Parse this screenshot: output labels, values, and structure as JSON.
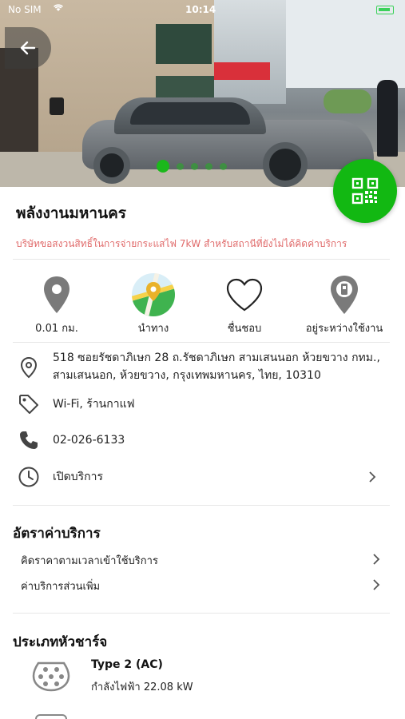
{
  "status_bar": {
    "carrier": "No SIM",
    "time": "10:14"
  },
  "hero": {
    "slides_count": 5,
    "active_slide": 1
  },
  "station": {
    "name": "พลังงานมหานคร",
    "notice": "บริษัทขอสงวนสิทธิ์ในการจ่ายกระแสไฟ 7kW สำหรับสถานีที่ยังไม่ได้คิดค่าบริการ"
  },
  "actions": [
    {
      "label": "0.01 กม.",
      "icon": "map-pin-icon"
    },
    {
      "label": "นำทาง",
      "icon": "maps-app-icon"
    },
    {
      "label": "ชื่นชอบ",
      "icon": "heart-icon"
    },
    {
      "label": "อยู่ระหว่างใช้งาน",
      "icon": "charging-pin-icon"
    }
  ],
  "info": {
    "address_line1": "518 ซอยรัชดาภิเษก 28 ถ.รัชดาภิเษก สามเสนนอก ห้วยขวาง กทม.,",
    "address_line2": "สามเสนนอก, ห้วยขวาง, กรุงเทพมหานคร, ไทย, 10310",
    "amenities": "Wi-Fi, ร้านกาแฟ",
    "phone": "02-026-6133",
    "hours": "เปิดบริการ"
  },
  "rates": {
    "title": "อัตราค่าบริการ",
    "items": [
      "คิดราคาตามเวลาเข้าใช้บริการ",
      "ค่าบริการส่วนเพิ่ม"
    ]
  },
  "plugs": {
    "title": "ประเภทหัวชาร์จ",
    "items": [
      {
        "name": "Type 2 (AC)",
        "power": "กำลังไฟฟ้า 22.08 kW"
      }
    ]
  },
  "colors": {
    "brand_green": "#12b812",
    "notice_red": "#e06a6a"
  }
}
